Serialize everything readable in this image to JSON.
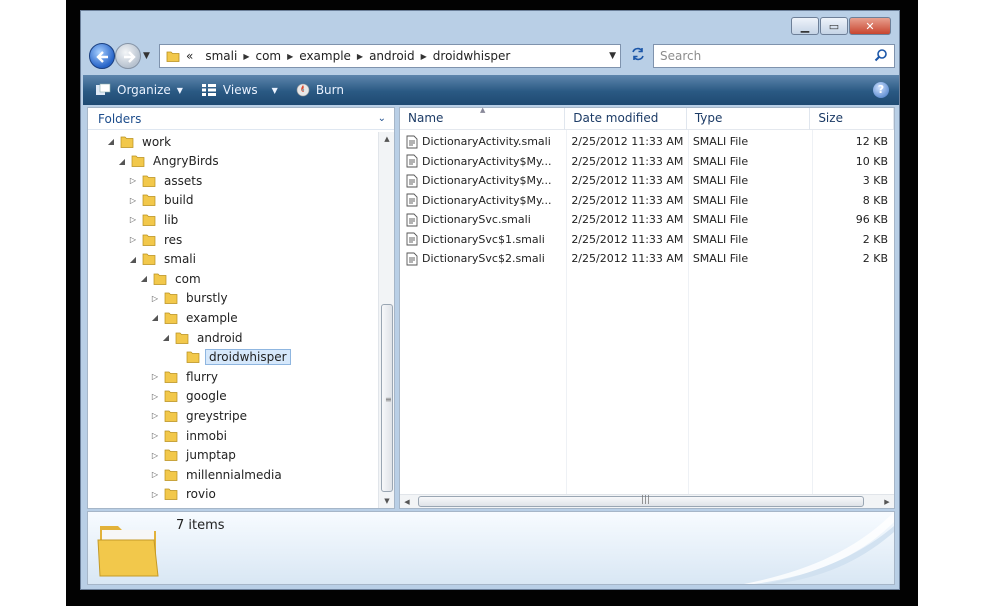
{
  "window": {
    "caption_buttons": {
      "minimize": "▁",
      "maximize": "▭",
      "close": "✕"
    }
  },
  "nav": {
    "address": {
      "overflow": "«",
      "crumbs": [
        "smali",
        "com",
        "example",
        "android",
        "droidwhisper"
      ]
    },
    "search_placeholder": "Search"
  },
  "toolbar": {
    "organize": "Organize",
    "views": "Views",
    "burn": "Burn",
    "help": "?"
  },
  "folder_pane": {
    "header": "Folders",
    "tree": [
      {
        "label": "work",
        "level": 1,
        "state": "expanded"
      },
      {
        "label": "AngryBirds",
        "level": 2,
        "state": "expanded"
      },
      {
        "label": "assets",
        "level": 3,
        "state": "collapsed"
      },
      {
        "label": "build",
        "level": 3,
        "state": "collapsed"
      },
      {
        "label": "lib",
        "level": 3,
        "state": "collapsed"
      },
      {
        "label": "res",
        "level": 3,
        "state": "collapsed"
      },
      {
        "label": "smali",
        "level": 3,
        "state": "expanded"
      },
      {
        "label": "com",
        "level": 4,
        "state": "expanded"
      },
      {
        "label": "burstly",
        "level": 5,
        "state": "collapsed"
      },
      {
        "label": "example",
        "level": 5,
        "state": "expanded"
      },
      {
        "label": "android",
        "level": 6,
        "state": "expanded"
      },
      {
        "label": "droidwhisper",
        "level": 7,
        "state": "leaf",
        "selected": true
      },
      {
        "label": "flurry",
        "level": 5,
        "state": "collapsed"
      },
      {
        "label": "google",
        "level": 5,
        "state": "collapsed"
      },
      {
        "label": "greystripe",
        "level": 5,
        "state": "collapsed"
      },
      {
        "label": "inmobi",
        "level": 5,
        "state": "collapsed"
      },
      {
        "label": "jumptap",
        "level": 5,
        "state": "collapsed"
      },
      {
        "label": "millennialmedia",
        "level": 5,
        "state": "collapsed"
      },
      {
        "label": "rovio",
        "level": 5,
        "state": "collapsed"
      }
    ]
  },
  "file_list": {
    "columns": [
      "Name",
      "Date modified",
      "Type",
      "Size"
    ],
    "rows": [
      {
        "name": "DictionaryActivity.smali",
        "date": "2/25/2012 11:33 AM",
        "type": "SMALI File",
        "size": "12 KB"
      },
      {
        "name": "DictionaryActivity$My...",
        "date": "2/25/2012 11:33 AM",
        "type": "SMALI File",
        "size": "10 KB"
      },
      {
        "name": "DictionaryActivity$My...",
        "date": "2/25/2012 11:33 AM",
        "type": "SMALI File",
        "size": "3 KB"
      },
      {
        "name": "DictionaryActivity$My...",
        "date": "2/25/2012 11:33 AM",
        "type": "SMALI File",
        "size": "8 KB"
      },
      {
        "name": "DictionarySvc.smali",
        "date": "2/25/2012 11:33 AM",
        "type": "SMALI File",
        "size": "96 KB"
      },
      {
        "name": "DictionarySvc$1.smali",
        "date": "2/25/2012 11:33 AM",
        "type": "SMALI File",
        "size": "2 KB"
      },
      {
        "name": "DictionarySvc$2.smali",
        "date": "2/25/2012 11:33 AM",
        "type": "SMALI File",
        "size": "2 KB"
      }
    ]
  },
  "details": {
    "item_count": "7 items"
  },
  "colors": {
    "toolbar": "#2a5983",
    "folder": "#f2c84b",
    "selection": "#d6e8fb",
    "chrome": "#b9cfe6"
  }
}
